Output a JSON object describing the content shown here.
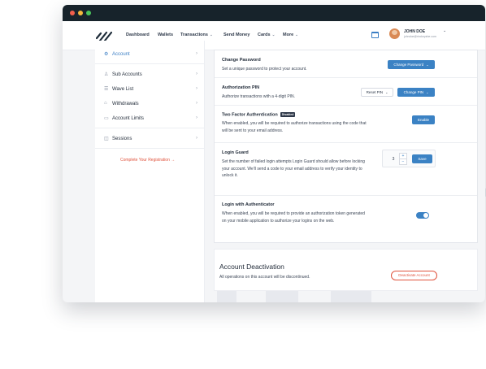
{
  "nav": {
    "items": [
      {
        "label": "Dashboard",
        "has_caret": false
      },
      {
        "label": "Wallets",
        "has_caret": false
      },
      {
        "label": "Transactions",
        "has_caret": true
      },
      {
        "label": "Send Money",
        "has_caret": false
      },
      {
        "label": "Cards",
        "has_caret": true
      },
      {
        "label": "More",
        "has_caret": true
      }
    ],
    "caret": "⌄",
    "user": {
      "name": "JOHN DOE",
      "email": "johndoe@rindoryshe.com"
    },
    "user_caret": "⌄"
  },
  "sidebar": {
    "items": [
      {
        "label": "Account",
        "icon": "gear-icon",
        "glyph": "⚙",
        "active": true
      },
      {
        "label": "Sub Accounts",
        "icon": "user-icon",
        "glyph": "♙",
        "active": false
      },
      {
        "label": "Wave List",
        "icon": "list-icon",
        "glyph": "☰",
        "active": false
      },
      {
        "label": "Withdrawals",
        "icon": "bank-icon",
        "glyph": "⌂",
        "active": false
      },
      {
        "label": "Account Limits",
        "icon": "card-icon",
        "glyph": "▭",
        "active": false
      },
      {
        "label": "Sessions",
        "icon": "session-icon",
        "glyph": "◫",
        "active": false
      }
    ],
    "chevron": "›",
    "cta": "Complete Your Registration  →"
  },
  "security": {
    "change_password": {
      "title": "Change Password",
      "desc": "Set a unique password to protect your account.",
      "button": "Change Password"
    },
    "authorization_pin": {
      "title": "Authorization PIN",
      "desc": "Authorize transactions with a 4-digit PIN.",
      "reset_button": "Reset PIN",
      "change_button": "Change PIN"
    },
    "two_factor": {
      "title": "Two Factor Authentication",
      "badge": "Disabled",
      "desc": "When enabled, you will be required to authorize transactions using the code that will be sent to your email address.",
      "button": "Enable"
    },
    "login_guard": {
      "title": "Login Guard",
      "desc": "Set the number of failed login attempts Login Guard should allow before locking your account. We'll send a code to your email address to verify your identity to unlock it.",
      "value": "3",
      "plus": "+",
      "minus": "−",
      "button": "Save"
    },
    "authenticator": {
      "title": "Login with Authenticator",
      "desc": "When enabled, you will be required to provide an authorization token generated on your mobile application to authorize your logins on the web.",
      "enabled": true
    }
  },
  "deactivation": {
    "title": "Account Deactivation",
    "desc": "All operations on this account will be discontinued.",
    "button": "Deactivate Account"
  },
  "colors": {
    "accent": "#3b82c4",
    "danger": "#e0533d",
    "titlebar": "#17232b"
  }
}
